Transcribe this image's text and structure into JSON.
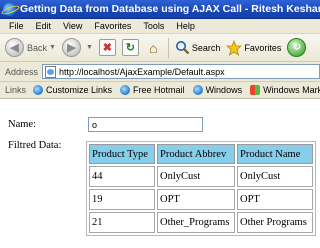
{
  "window": {
    "title": "Getting Data from Database using AJAX Call - Ritesh Kesharwani"
  },
  "menu": [
    "File",
    "Edit",
    "View",
    "Favorites",
    "Tools",
    "Help"
  ],
  "toolbar": {
    "back_label": "Back",
    "search_label": "Search",
    "favorites_label": "Favorites"
  },
  "address": {
    "label": "Address",
    "url": "http://localhost/AjaxExample/Default.aspx"
  },
  "links": {
    "label": "Links",
    "items": [
      "Customize Links",
      "Free Hotmail",
      "Windows",
      "Windows Marketplace"
    ]
  },
  "form": {
    "name_label": "Name:",
    "name_value": "o",
    "filtered_label": "Filtred Data:"
  },
  "table": {
    "headers": [
      "Product Type",
      "Product Abbrev",
      "Product Name"
    ],
    "rows": [
      [
        "44",
        "OnlyCust",
        "OnlyCust"
      ],
      [
        "19",
        "OPT",
        "OPT"
      ],
      [
        "21",
        "Other_Programs",
        "Other Programs"
      ]
    ]
  },
  "colors": {
    "title_bar": "#1a47b8",
    "chrome": "#ece9d8",
    "table_header": "#87ceeb"
  }
}
